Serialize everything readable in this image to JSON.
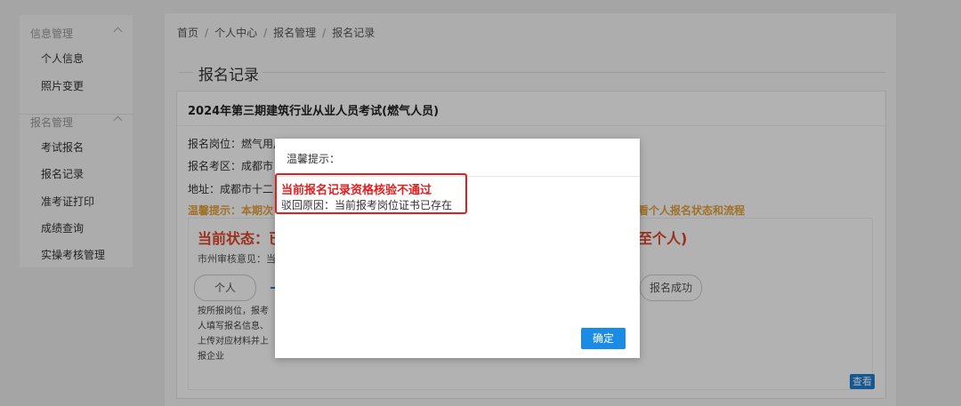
{
  "sidebar": {
    "groups": [
      {
        "label": "信息管理",
        "items": [
          "个人信息",
          "照片变更"
        ]
      },
      {
        "label": "报名管理",
        "items": [
          "考试报名",
          "报名记录",
          "准考证打印",
          "成绩查询",
          "实操考核管理"
        ]
      }
    ]
  },
  "breadcrumb": [
    "首页",
    "个人中心",
    "报名管理",
    "报名记录"
  ],
  "page": {
    "section_title": "报名记录",
    "card_title": "2024年第三期建筑行业从业人员考试(燃气人员)",
    "position_label": "报名岗位：",
    "position_value": "燃气用户",
    "area_label": "报名考区：",
    "area_value": "成都市",
    "address_label": "地址：",
    "address_value": "成都市十二",
    "tip_left": "温馨提示：本期次",
    "tip_right": "看个人报名状态和流程",
    "status_left": "当前状态：已",
    "status_right": "至个人)",
    "review_label": "市州审核意见：当",
    "steps": {
      "first": "个人",
      "last": "报名成功"
    },
    "step_desc": "按所报岗位，报考人填写报名信息、上传对应材料并上报企业",
    "view_button": "查看"
  },
  "modal": {
    "title": "温馨提示：",
    "message": "当前报名记录资格核验不通过",
    "reason": "驳回原因：当前报考岗位证书已存在",
    "ok_button": "确定"
  },
  "colors": {
    "primary": "#1b8ce6",
    "alert_red": "#e02020",
    "status_red": "#e0462b",
    "tip_orange": "#e6a23c"
  }
}
